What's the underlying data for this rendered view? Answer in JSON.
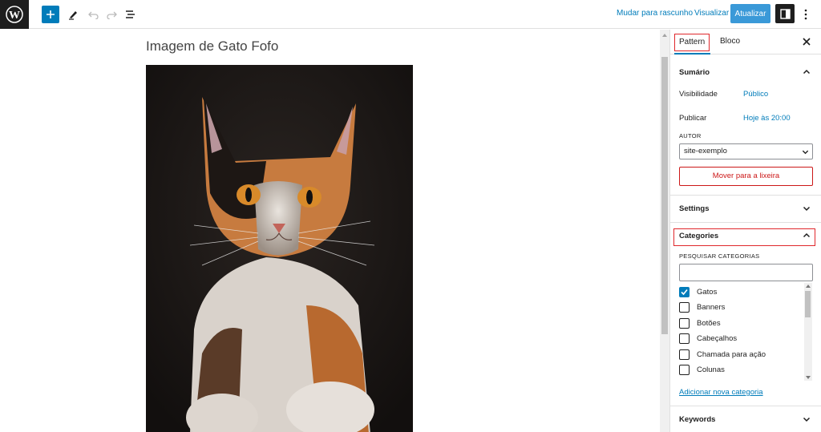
{
  "toolbar": {
    "logo_icon": "wordpress-logo",
    "add_icon": "plus-icon",
    "tools_icon": "pencil-icon",
    "undo_icon": "undo-icon",
    "redo_icon": "redo-icon",
    "outline_icon": "list-view-icon",
    "draft_label": "Mudar para rascunho",
    "preview_label": "Visualizar",
    "update_label": "Atualizar",
    "settings_icon": "sidebar-toggle-icon",
    "options_icon": "kebab-menu-icon",
    "accent": "#007cba"
  },
  "editor": {
    "title": "Imagem de Gato Fofo",
    "image_subject": "calico-kitten-photo"
  },
  "sidebar": {
    "tabs": [
      {
        "label": "Pattern",
        "active": true
      },
      {
        "label": "Bloco",
        "active": false
      }
    ],
    "close_icon": "close-icon",
    "summary": {
      "title": "Sumário",
      "visibility_label": "Visibilidade",
      "visibility_value": "Público",
      "publish_label": "Publicar",
      "publish_value": "Hoje às 20:00",
      "author_label": "AUTOR",
      "author_value": "site-exemplo",
      "trash_label": "Mover para a lixeira"
    },
    "settings": {
      "title": "Settings"
    },
    "categories": {
      "title": "Categories",
      "search_label": "PESQUISAR CATEGORIAS",
      "search_value": "",
      "items": [
        {
          "label": "Gatos",
          "checked": true
        },
        {
          "label": "Banners",
          "checked": false
        },
        {
          "label": "Botões",
          "checked": false
        },
        {
          "label": "Cabeçalhos",
          "checked": false
        },
        {
          "label": "Chamada para ação",
          "checked": false
        },
        {
          "label": "Colunas",
          "checked": false
        }
      ],
      "add_label": "Adicionar nova categoria"
    },
    "keywords": {
      "title": "Keywords"
    }
  }
}
